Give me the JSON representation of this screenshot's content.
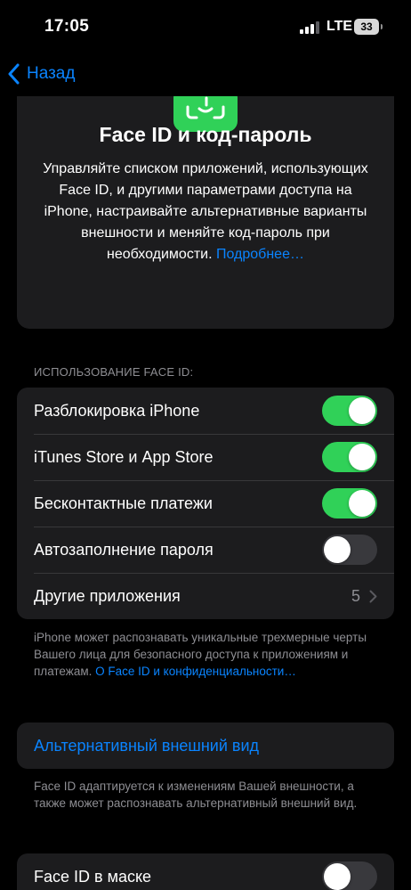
{
  "status_bar": {
    "time": "17:05",
    "network": "LTE",
    "battery": "33"
  },
  "nav": {
    "back_label": "Назад"
  },
  "header": {
    "title": "Face ID и код-пароль",
    "description": "Управляйте списком приложений, использующих Face ID, и другими параметрами доступа на iPhone, настраивайте альтернативные варианты внешности и меняйте код-пароль при необходимости.",
    "link": "Подробнее…",
    "icon": "faceid-icon",
    "icon_color": "#30d158"
  },
  "use_face_id": {
    "header": "ИСПОЛЬЗОВАНИЕ FACE ID:",
    "rows": [
      {
        "label": "Разблокировка iPhone",
        "toggle": true
      },
      {
        "label": "iTunes Store и App Store",
        "toggle": true
      },
      {
        "label": "Бесконтактные платежи",
        "toggle": true
      },
      {
        "label": "Автозаполнение пароля",
        "toggle": false
      }
    ],
    "other_apps": {
      "label": "Другие приложения",
      "value": "5"
    },
    "footer": "iPhone может распознавать уникальные трехмерные черты Вашего лица для безопасного доступа к приложениям и платежам.",
    "footer_link": "О Face ID и конфиденциальности…"
  },
  "alternate_appearance": {
    "label": "Альтернативный внешний вид",
    "footer": "Face ID адаптируется к изменениям Вашей внешности, а также может распознавать альтернативный внешний вид."
  },
  "mask": {
    "label": "Face ID в маске",
    "toggle": false
  },
  "colors": {
    "accent": "#0a84ff",
    "toggle_on": "#30d158",
    "cell_bg": "#1c1c1e",
    "secondary_text": "#8e8e93"
  }
}
